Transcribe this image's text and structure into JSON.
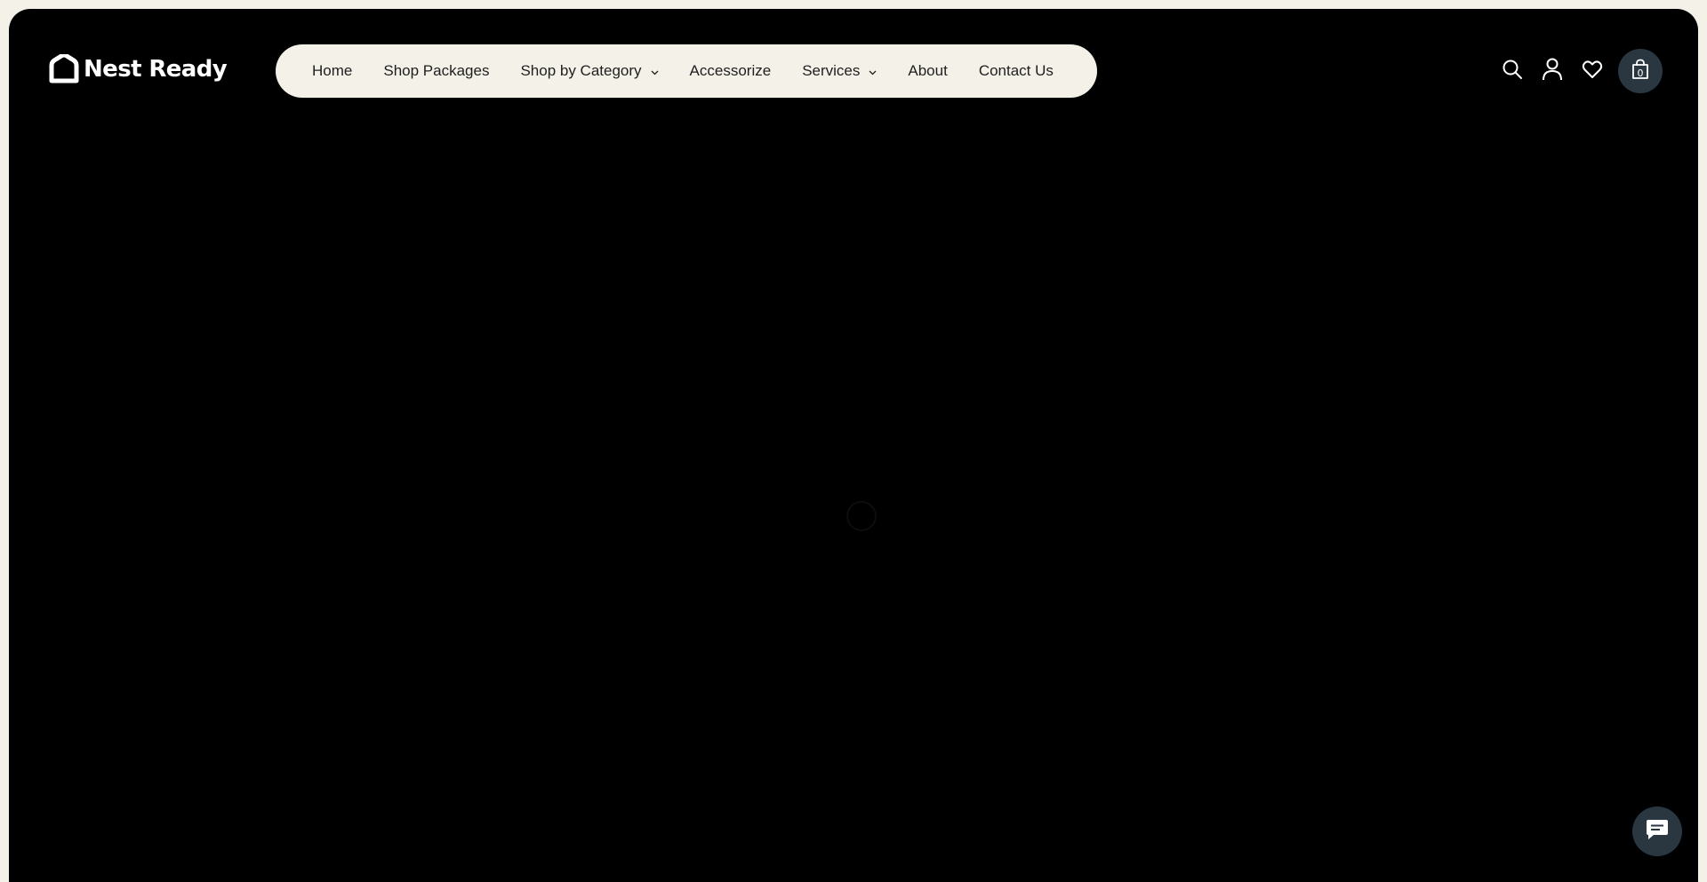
{
  "brand": {
    "name": "Nest Ready",
    "logo_icon": "house-outline-icon"
  },
  "nav": {
    "items": [
      {
        "label": "Home",
        "has_dropdown": false
      },
      {
        "label": "Shop Packages",
        "has_dropdown": false
      },
      {
        "label": "Shop by Category",
        "has_dropdown": true
      },
      {
        "label": "Accessorize",
        "has_dropdown": false
      },
      {
        "label": "Services",
        "has_dropdown": true
      },
      {
        "label": "About",
        "has_dropdown": false
      },
      {
        "label": "Contact Us",
        "has_dropdown": false
      }
    ]
  },
  "header_icons": {
    "search": "search-icon",
    "account": "user-icon",
    "wishlist": "heart-icon",
    "cart": "shopping-bag-icon",
    "cart_count": "0"
  },
  "hero": {
    "state": "loading",
    "loader_icon": "spinner-icon"
  },
  "chat": {
    "icon": "chat-bubble-icon"
  },
  "colors": {
    "page_background": "#f3f1e8",
    "frame_background": "#000000",
    "nav_pill": "#f3f1e8",
    "accent_button": "#2b3740",
    "nav_text": "#1f1f1f",
    "icon_color": "#ffffff"
  }
}
